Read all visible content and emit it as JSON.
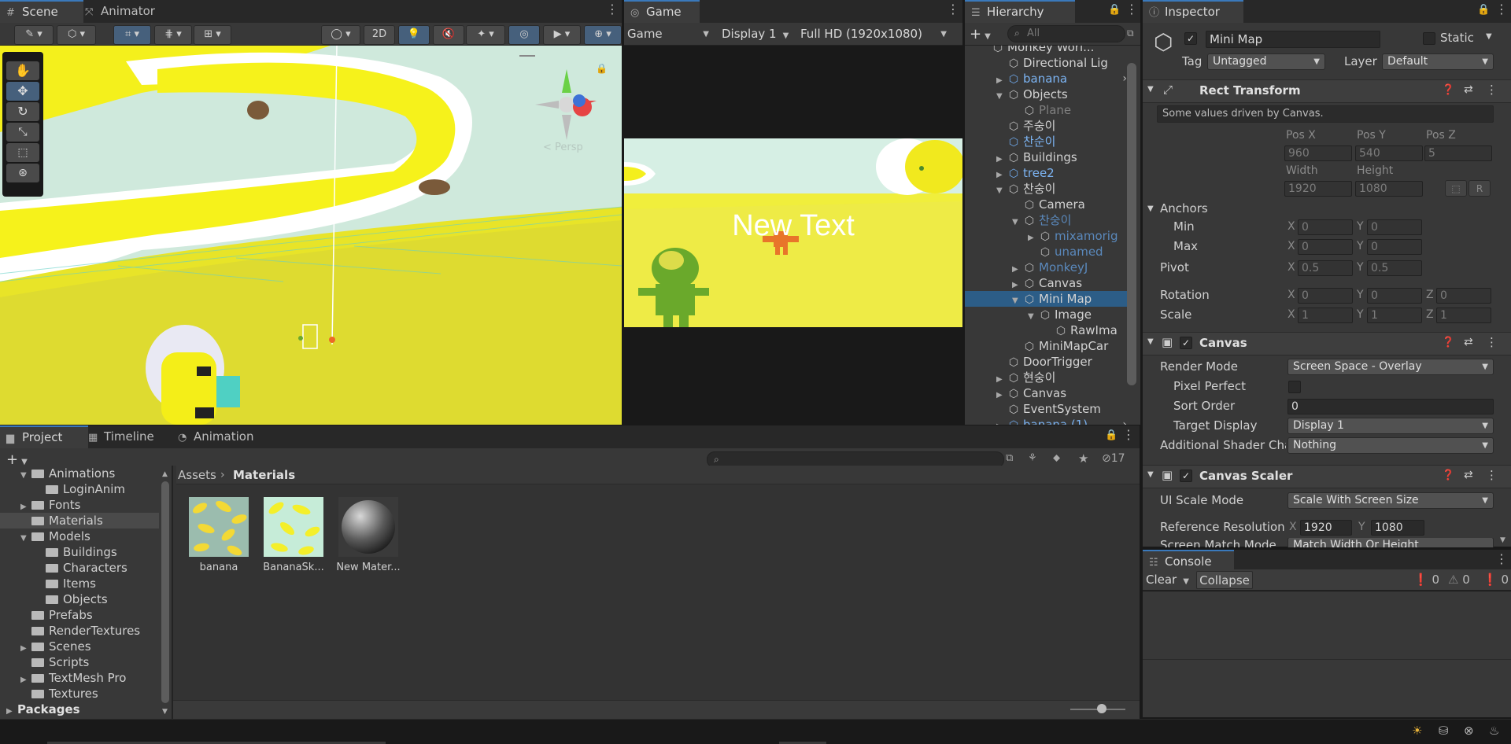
{
  "scene_tabs": [
    {
      "icon": "#",
      "label": "Scene"
    },
    {
      "icon": "⤧",
      "label": "Animator"
    }
  ],
  "scene_toolbar": {
    "mode_2d": "2D"
  },
  "scene_view": {
    "persp_label": "< Persp"
  },
  "game": {
    "tab_label": "Game",
    "mode": "Game",
    "display": "Display 1",
    "resolution": "Full HD (1920x1080)",
    "ui_text": "New Text"
  },
  "hierarchy": {
    "tab_label": "Hierarchy",
    "search_placeholder": "All",
    "items": [
      {
        "label": "Monkey Worl...",
        "depth": 0,
        "kind": "scene",
        "arrow": ""
      },
      {
        "label": "Directional Lig",
        "depth": 1,
        "kind": "go",
        "arrow": ""
      },
      {
        "label": "banana",
        "depth": 1,
        "kind": "prefab",
        "arrow": "right",
        "more": true
      },
      {
        "label": "Objects",
        "depth": 1,
        "kind": "go",
        "arrow": "down"
      },
      {
        "label": "Plane",
        "depth": 2,
        "kind": "dim",
        "arrow": ""
      },
      {
        "label": "주숭이",
        "depth": 1,
        "kind": "go",
        "arrow": ""
      },
      {
        "label": "찬순이",
        "depth": 1,
        "kind": "prefab",
        "arrow": ""
      },
      {
        "label": "Buildings",
        "depth": 1,
        "kind": "go",
        "arrow": "right"
      },
      {
        "label": "tree2",
        "depth": 1,
        "kind": "prefab",
        "arrow": "right"
      },
      {
        "label": "찬숭이",
        "depth": 1,
        "kind": "go",
        "arrow": "down"
      },
      {
        "label": "Camera",
        "depth": 2,
        "kind": "go",
        "arrow": ""
      },
      {
        "label": "찬숭이",
        "depth": 2,
        "kind": "pdim",
        "arrow": "down"
      },
      {
        "label": "mixamorig",
        "depth": 3,
        "kind": "pdim",
        "arrow": "right"
      },
      {
        "label": "unamed",
        "depth": 3,
        "kind": "pdim",
        "arrow": ""
      },
      {
        "label": "MonkeyJ",
        "depth": 2,
        "kind": "pdim",
        "arrow": "right"
      },
      {
        "label": "Canvas",
        "depth": 2,
        "kind": "go",
        "arrow": "right"
      },
      {
        "label": "Mini Map",
        "depth": 2,
        "kind": "go",
        "arrow": "down",
        "selected": true
      },
      {
        "label": "Image",
        "depth": 3,
        "kind": "go",
        "arrow": "down"
      },
      {
        "label": "RawIma",
        "depth": 4,
        "kind": "go",
        "arrow": ""
      },
      {
        "label": "MiniMapCar",
        "depth": 2,
        "kind": "go",
        "arrow": ""
      },
      {
        "label": "DoorTrigger",
        "depth": 1,
        "kind": "go",
        "arrow": ""
      },
      {
        "label": "현숭이",
        "depth": 1,
        "kind": "go",
        "arrow": "right"
      },
      {
        "label": "Canvas",
        "depth": 1,
        "kind": "go",
        "arrow": "right"
      },
      {
        "label": "EventSystem",
        "depth": 1,
        "kind": "go",
        "arrow": ""
      },
      {
        "label": "banana (1)",
        "depth": 1,
        "kind": "prefab",
        "arrow": "right",
        "more": true
      }
    ]
  },
  "inspector": {
    "tab_label": "Inspector",
    "object_name": "Mini Map",
    "static_label": "Static",
    "tag_label": "Tag",
    "tag_value": "Untagged",
    "layer_label": "Layer",
    "layer_value": "Default",
    "rect_transform": {
      "title": "Rect Transform",
      "note": "Some values driven by Canvas.",
      "posx_label": "Pos X",
      "posy_label": "Pos Y",
      "posz_label": "Pos Z",
      "posx": "960",
      "posy": "540",
      "posz": "5",
      "width_label": "Width",
      "height_label": "Height",
      "width": "1920",
      "height": "1080",
      "r_btn": "R",
      "anchors": "Anchors",
      "min": "Min",
      "max": "Max",
      "min_x": "0",
      "min_y": "0",
      "max_x": "0",
      "max_y": "0",
      "pivot": "Pivot",
      "pivot_x": "0.5",
      "pivot_y": "0.5",
      "rotation": "Rotation",
      "rot_x": "0",
      "rot_y": "0",
      "rot_z": "0",
      "scale": "Scale",
      "scale_x": "1",
      "scale_y": "1",
      "scale_z": "1",
      "x": "X",
      "y": "Y",
      "z": "Z"
    },
    "canvas": {
      "title": "Canvas",
      "render_mode_label": "Render Mode",
      "render_mode": "Screen Space - Overlay",
      "pixel_perfect_label": "Pixel Perfect",
      "sort_order_label": "Sort Order",
      "sort_order": "0",
      "target_display_label": "Target Display",
      "target_display": "Display 1",
      "shader_label": "Additional Shader Cha",
      "shader_value": "Nothing"
    },
    "canvas_scaler": {
      "title": "Canvas Scaler",
      "ui_scale_label": "UI Scale Mode",
      "ui_scale_value": "Scale With Screen Size",
      "ref_res_label": "Reference Resolution",
      "ref_x": "1920",
      "ref_y": "1080",
      "match_label": "Screen Match Mode",
      "match_value": "Match Width Or Height"
    }
  },
  "console": {
    "tab_label": "Console",
    "clear": "Clear",
    "collapse": "Collapse",
    "info_count": "0",
    "warn_count": "0",
    "error_count": "0"
  },
  "project": {
    "tabs": [
      {
        "icon": "▆",
        "label": "Project"
      },
      {
        "icon": "▦",
        "label": "Timeline"
      },
      {
        "icon": "◔",
        "label": "Animation"
      }
    ],
    "hidden_count": "17",
    "tree": [
      {
        "label": "Animations",
        "depth": 1,
        "arrow": "down"
      },
      {
        "label": "LoginAnim",
        "depth": 2,
        "arrow": ""
      },
      {
        "label": "Fonts",
        "depth": 1,
        "arrow": "right"
      },
      {
        "label": "Materials",
        "depth": 1,
        "arrow": "",
        "selected": true
      },
      {
        "label": "Models",
        "depth": 1,
        "arrow": "down"
      },
      {
        "label": "Buildings",
        "depth": 2,
        "arrow": ""
      },
      {
        "label": "Characters",
        "depth": 2,
        "arrow": ""
      },
      {
        "label": "Items",
        "depth": 2,
        "arrow": ""
      },
      {
        "label": "Objects",
        "depth": 2,
        "arrow": ""
      },
      {
        "label": "Prefabs",
        "depth": 1,
        "arrow": ""
      },
      {
        "label": "RenderTextures",
        "depth": 1,
        "arrow": ""
      },
      {
        "label": "Scenes",
        "depth": 1,
        "arrow": "right"
      },
      {
        "label": "Scripts",
        "depth": 1,
        "arrow": ""
      },
      {
        "label": "TextMesh Pro",
        "depth": 1,
        "arrow": "right"
      },
      {
        "label": "Textures",
        "depth": 1,
        "arrow": ""
      },
      {
        "label": "Packages",
        "depth": 0,
        "arrow": "right",
        "bold": true
      }
    ],
    "breadcrumb": [
      "Assets",
      "Materials"
    ],
    "assets": [
      {
        "label": "banana",
        "kind": "banana"
      },
      {
        "label": "BananaSk...",
        "kind": "bananask"
      },
      {
        "label": "New Mater...",
        "kind": "sphere"
      }
    ]
  },
  "colors": {
    "accent": "#3a79bb",
    "selection": "#2c5d87",
    "prefab": "#7cb4f3"
  }
}
